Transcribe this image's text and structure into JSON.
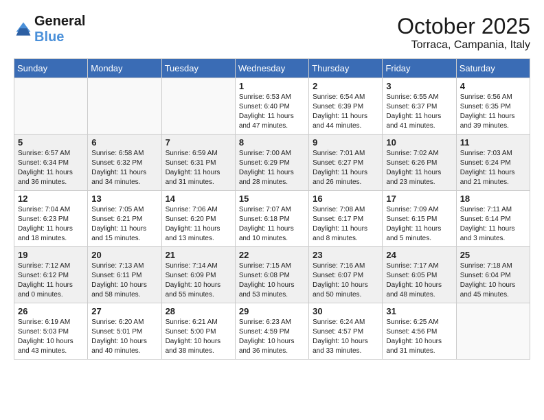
{
  "header": {
    "logo_line1": "General",
    "logo_line2": "Blue",
    "month": "October 2025",
    "location": "Torraca, Campania, Italy"
  },
  "days_of_week": [
    "Sunday",
    "Monday",
    "Tuesday",
    "Wednesday",
    "Thursday",
    "Friday",
    "Saturday"
  ],
  "weeks": [
    [
      {
        "day": "",
        "info": ""
      },
      {
        "day": "",
        "info": ""
      },
      {
        "day": "",
        "info": ""
      },
      {
        "day": "1",
        "info": "Sunrise: 6:53 AM\nSunset: 6:40 PM\nDaylight: 11 hours\nand 47 minutes."
      },
      {
        "day": "2",
        "info": "Sunrise: 6:54 AM\nSunset: 6:39 PM\nDaylight: 11 hours\nand 44 minutes."
      },
      {
        "day": "3",
        "info": "Sunrise: 6:55 AM\nSunset: 6:37 PM\nDaylight: 11 hours\nand 41 minutes."
      },
      {
        "day": "4",
        "info": "Sunrise: 6:56 AM\nSunset: 6:35 PM\nDaylight: 11 hours\nand 39 minutes."
      }
    ],
    [
      {
        "day": "5",
        "info": "Sunrise: 6:57 AM\nSunset: 6:34 PM\nDaylight: 11 hours\nand 36 minutes."
      },
      {
        "day": "6",
        "info": "Sunrise: 6:58 AM\nSunset: 6:32 PM\nDaylight: 11 hours\nand 34 minutes."
      },
      {
        "day": "7",
        "info": "Sunrise: 6:59 AM\nSunset: 6:31 PM\nDaylight: 11 hours\nand 31 minutes."
      },
      {
        "day": "8",
        "info": "Sunrise: 7:00 AM\nSunset: 6:29 PM\nDaylight: 11 hours\nand 28 minutes."
      },
      {
        "day": "9",
        "info": "Sunrise: 7:01 AM\nSunset: 6:27 PM\nDaylight: 11 hours\nand 26 minutes."
      },
      {
        "day": "10",
        "info": "Sunrise: 7:02 AM\nSunset: 6:26 PM\nDaylight: 11 hours\nand 23 minutes."
      },
      {
        "day": "11",
        "info": "Sunrise: 7:03 AM\nSunset: 6:24 PM\nDaylight: 11 hours\nand 21 minutes."
      }
    ],
    [
      {
        "day": "12",
        "info": "Sunrise: 7:04 AM\nSunset: 6:23 PM\nDaylight: 11 hours\nand 18 minutes."
      },
      {
        "day": "13",
        "info": "Sunrise: 7:05 AM\nSunset: 6:21 PM\nDaylight: 11 hours\nand 15 minutes."
      },
      {
        "day": "14",
        "info": "Sunrise: 7:06 AM\nSunset: 6:20 PM\nDaylight: 11 hours\nand 13 minutes."
      },
      {
        "day": "15",
        "info": "Sunrise: 7:07 AM\nSunset: 6:18 PM\nDaylight: 11 hours\nand 10 minutes."
      },
      {
        "day": "16",
        "info": "Sunrise: 7:08 AM\nSunset: 6:17 PM\nDaylight: 11 hours\nand 8 minutes."
      },
      {
        "day": "17",
        "info": "Sunrise: 7:09 AM\nSunset: 6:15 PM\nDaylight: 11 hours\nand 5 minutes."
      },
      {
        "day": "18",
        "info": "Sunrise: 7:11 AM\nSunset: 6:14 PM\nDaylight: 11 hours\nand 3 minutes."
      }
    ],
    [
      {
        "day": "19",
        "info": "Sunrise: 7:12 AM\nSunset: 6:12 PM\nDaylight: 11 hours\nand 0 minutes."
      },
      {
        "day": "20",
        "info": "Sunrise: 7:13 AM\nSunset: 6:11 PM\nDaylight: 10 hours\nand 58 minutes."
      },
      {
        "day": "21",
        "info": "Sunrise: 7:14 AM\nSunset: 6:09 PM\nDaylight: 10 hours\nand 55 minutes."
      },
      {
        "day": "22",
        "info": "Sunrise: 7:15 AM\nSunset: 6:08 PM\nDaylight: 10 hours\nand 53 minutes."
      },
      {
        "day": "23",
        "info": "Sunrise: 7:16 AM\nSunset: 6:07 PM\nDaylight: 10 hours\nand 50 minutes."
      },
      {
        "day": "24",
        "info": "Sunrise: 7:17 AM\nSunset: 6:05 PM\nDaylight: 10 hours\nand 48 minutes."
      },
      {
        "day": "25",
        "info": "Sunrise: 7:18 AM\nSunset: 6:04 PM\nDaylight: 10 hours\nand 45 minutes."
      }
    ],
    [
      {
        "day": "26",
        "info": "Sunrise: 6:19 AM\nSunset: 5:03 PM\nDaylight: 10 hours\nand 43 minutes."
      },
      {
        "day": "27",
        "info": "Sunrise: 6:20 AM\nSunset: 5:01 PM\nDaylight: 10 hours\nand 40 minutes."
      },
      {
        "day": "28",
        "info": "Sunrise: 6:21 AM\nSunset: 5:00 PM\nDaylight: 10 hours\nand 38 minutes."
      },
      {
        "day": "29",
        "info": "Sunrise: 6:23 AM\nSunset: 4:59 PM\nDaylight: 10 hours\nand 36 minutes."
      },
      {
        "day": "30",
        "info": "Sunrise: 6:24 AM\nSunset: 4:57 PM\nDaylight: 10 hours\nand 33 minutes."
      },
      {
        "day": "31",
        "info": "Sunrise: 6:25 AM\nSunset: 4:56 PM\nDaylight: 10 hours\nand 31 minutes."
      },
      {
        "day": "",
        "info": ""
      }
    ]
  ]
}
